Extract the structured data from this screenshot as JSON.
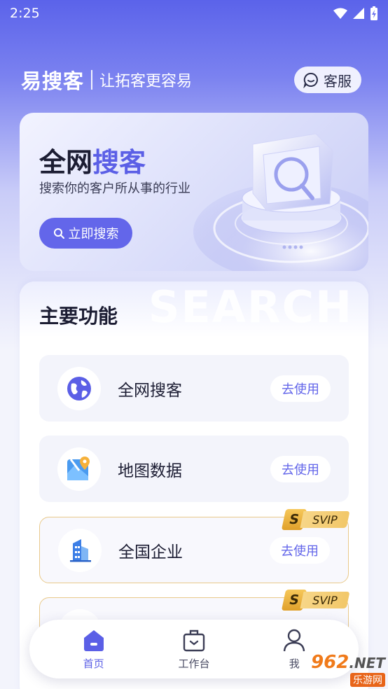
{
  "status_bar": {
    "time": "2:25"
  },
  "header": {
    "brand": "易搜客",
    "slogan": "让拓客更容易",
    "service_label": "客服"
  },
  "hero": {
    "title_prefix": "全网",
    "title_accent": "搜客",
    "subtitle": "搜索你的客户所从事的行业",
    "button_label": "立即搜索"
  },
  "main": {
    "title": "主要功能",
    "watermark": "SEARCH",
    "items": [
      {
        "label": "全网搜客",
        "button": "去使用",
        "icon": "globe-icon",
        "svip": false
      },
      {
        "label": "地图数据",
        "button": "去使用",
        "icon": "map-pin-icon",
        "svip": false
      },
      {
        "label": "全国企业",
        "button": "去使用",
        "icon": "building-icon",
        "svip": true,
        "badge_s": "S",
        "badge_text": "SVIP"
      },
      {
        "label": "",
        "button": "",
        "icon": "",
        "svip": true,
        "badge_s": "S",
        "badge_text": "SVIP"
      }
    ]
  },
  "tabbar": {
    "tabs": [
      {
        "label": "首页",
        "icon": "home-icon",
        "active": true
      },
      {
        "label": "工作台",
        "icon": "briefcase-icon",
        "active": false
      },
      {
        "label": "我",
        "icon": "user-icon",
        "active": false
      }
    ]
  },
  "watermark": {
    "main": "962",
    "domain": ".NET",
    "sub": "乐游网"
  },
  "colors": {
    "accent": "#5b5fe6",
    "svip_gold": "#f2c768"
  }
}
